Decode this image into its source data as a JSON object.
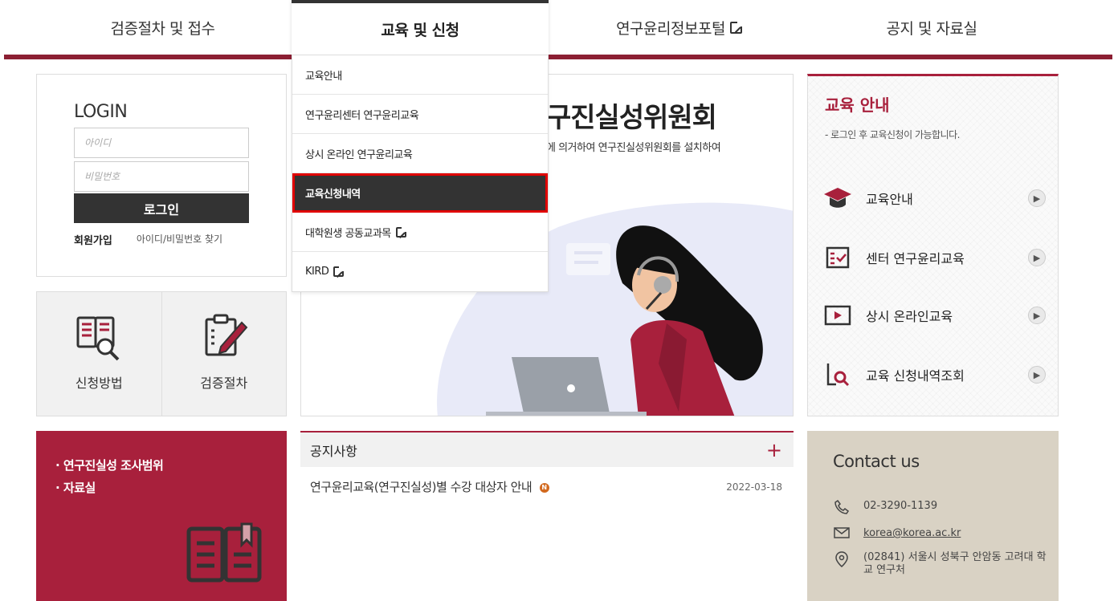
{
  "nav": {
    "items": [
      "검증절차 및 접수",
      "교육 및 신청",
      "연구윤리정보포털",
      "공지 및 자료실"
    ]
  },
  "dropdown": {
    "items": [
      "교육안내",
      "연구윤리센터 연구윤리교육",
      "상시 온라인 연구윤리교육",
      "교육신청내역",
      "대학원생 공동교과목",
      "KIRD"
    ]
  },
  "login": {
    "title": "LOGIN",
    "id_placeholder": "아이디",
    "pw_placeholder": "비밀번호",
    "button": "로그인",
    "join": "회원가입",
    "find": "아이디/비밀번호 찾기"
  },
  "quick": {
    "items": [
      "신청방법",
      "검증절차"
    ]
  },
  "banner": {
    "title": "구진실성위원회",
    "subtitle": "에 의거하여 연구진실성위원회를 설치하여"
  },
  "guide": {
    "title": "교육 안내",
    "subtitle": "- 로그인 후 교육신청이 가능합니다.",
    "items": [
      "교육안내",
      "센터 연구윤리교육",
      "상시 온라인교육",
      "교육 신청내역조회"
    ]
  },
  "red_box": {
    "items": [
      "· 연구진실성 조사범위",
      "· 자료실"
    ]
  },
  "notice": {
    "title": "공지사항",
    "more": "+",
    "rows": [
      {
        "title": "연구윤리교육(연구진실성)별 수강 대상자 안내",
        "badge": "N",
        "date": "2022-03-18"
      }
    ]
  },
  "contact": {
    "title": "Contact us",
    "phone": "02-3290-1139",
    "email": "korea@korea.ac.kr",
    "address": "(02841) 서울시 성북구 안암동 고려대 학교 연구처"
  },
  "colors": {
    "brand": "#a8203c",
    "nav_bar": "#8c1f33",
    "dark": "#333333",
    "contact_bg": "#d9d2c4",
    "highlight": "#e00000"
  }
}
